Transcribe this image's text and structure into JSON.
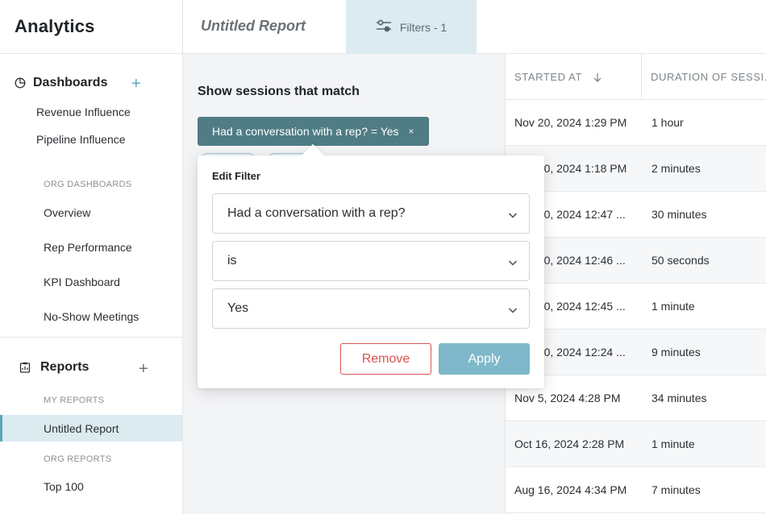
{
  "app": {
    "title": "Analytics"
  },
  "sidebar": {
    "dashboards": {
      "title": "Dashboards",
      "items": [
        "Revenue Influence",
        "Pipeline Influence"
      ],
      "org_caption": "ORG DASHBOARDS",
      "org_items": [
        "Overview",
        "Rep Performance",
        "KPI Dashboard",
        "No-Show Meetings"
      ]
    },
    "reports": {
      "title": "Reports",
      "my_caption": "MY REPORTS",
      "my_items": [
        "Untitled Report"
      ],
      "org_caption": "ORG REPORTS",
      "org_items": [
        "Top 100"
      ]
    }
  },
  "topbar": {
    "report_title": "Untitled Report",
    "filters_label": "Filters - 1"
  },
  "filter_panel": {
    "heading": "Show sessions that match",
    "active_chip": "Had a conversation with a rep? = Yes",
    "chip_close": "×"
  },
  "edit_filter": {
    "title": "Edit Filter",
    "field": "Had a conversation with a rep?",
    "operator": "is",
    "value": "Yes",
    "remove_label": "Remove",
    "apply_label": "Apply"
  },
  "table": {
    "columns": [
      "STARTED AT",
      "DURATION OF SESSI..."
    ],
    "rows": [
      {
        "started": "Nov 20, 2024 1:29 PM",
        "duration": "1 hour"
      },
      {
        "started": "Nov 20, 2024 1:18 PM",
        "duration": "2 minutes"
      },
      {
        "started": "Nov 20, 2024 12:47 ...",
        "duration": "30 minutes"
      },
      {
        "started": "Nov 20, 2024 12:46 ...",
        "duration": "50 seconds"
      },
      {
        "started": "Nov 20, 2024 12:45 ...",
        "duration": "1 minute"
      },
      {
        "started": "Nov 20, 2024 12:24 ...",
        "duration": "9 minutes"
      },
      {
        "started": "Nov 5, 2024 4:28 PM",
        "duration": "34 minutes"
      },
      {
        "started": "Oct 16, 2024 2:28 PM",
        "duration": "1 minute"
      },
      {
        "started": "Aug 16, 2024 4:34 PM",
        "duration": "7 minutes"
      }
    ]
  },
  "colors": {
    "accent": "#5aa6bf",
    "chip": "#4f7c85",
    "active_bg": "#dcebf0",
    "remove": "#d9534f",
    "apply": "#7fb8ca"
  }
}
